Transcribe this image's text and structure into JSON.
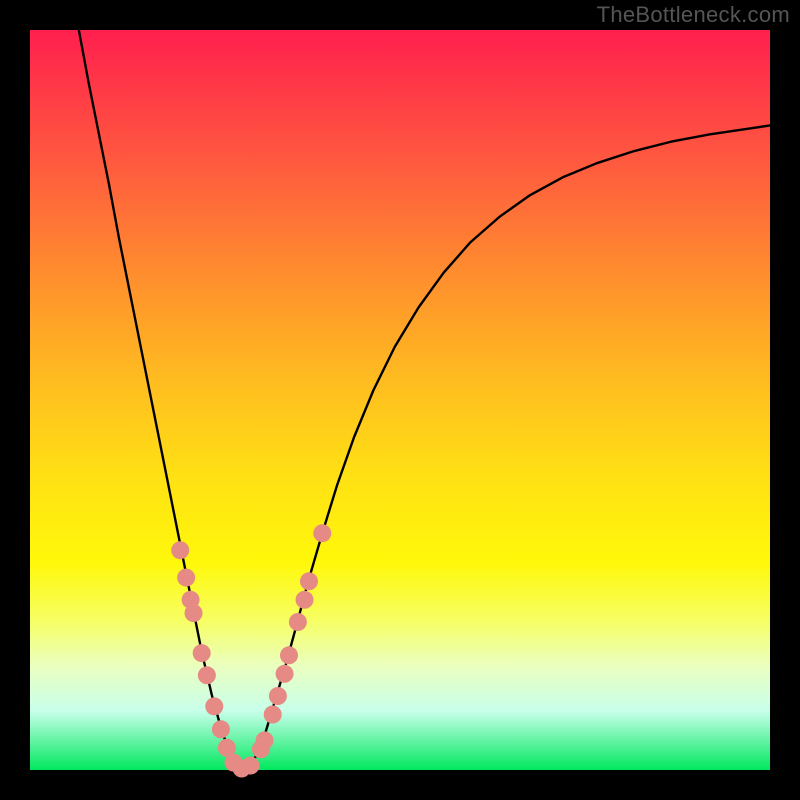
{
  "attribution": "TheBottleneck.com",
  "chart_data": {
    "type": "line",
    "title": "",
    "xlabel": "",
    "ylabel": "",
    "xlim": [
      0,
      1
    ],
    "ylim": [
      0,
      1
    ],
    "grid": false,
    "series": [
      {
        "name": "curve",
        "stroke": "#000000",
        "stroke_width": 2.4,
        "x": [
          0.066,
          0.079,
          0.093,
          0.107,
          0.12,
          0.134,
          0.148,
          0.162,
          0.176,
          0.19,
          0.204,
          0.218,
          0.232,
          0.246,
          0.26,
          0.272,
          0.281,
          0.289,
          0.296,
          0.306,
          0.318,
          0.33,
          0.345,
          0.36,
          0.376,
          0.395,
          0.415,
          0.438,
          0.464,
          0.493,
          0.525,
          0.559,
          0.595,
          0.635,
          0.676,
          0.72,
          0.766,
          0.815,
          0.866,
          0.919,
          0.973,
          1.0
        ],
        "y": [
          1.0,
          0.93,
          0.86,
          0.79,
          0.72,
          0.65,
          0.58,
          0.51,
          0.44,
          0.37,
          0.3,
          0.23,
          0.16,
          0.1,
          0.05,
          0.02,
          0.005,
          0.0,
          0.004,
          0.02,
          0.05,
          0.09,
          0.14,
          0.195,
          0.255,
          0.32,
          0.385,
          0.45,
          0.513,
          0.572,
          0.625,
          0.672,
          0.713,
          0.748,
          0.777,
          0.801,
          0.82,
          0.836,
          0.849,
          0.859,
          0.867,
          0.871
        ]
      }
    ],
    "markers": {
      "color": "#e58a84",
      "radius": 9,
      "points": [
        {
          "x": 0.203,
          "y": 0.297
        },
        {
          "x": 0.211,
          "y": 0.26
        },
        {
          "x": 0.217,
          "y": 0.23
        },
        {
          "x": 0.221,
          "y": 0.212
        },
        {
          "x": 0.232,
          "y": 0.158
        },
        {
          "x": 0.239,
          "y": 0.128
        },
        {
          "x": 0.249,
          "y": 0.086
        },
        {
          "x": 0.258,
          "y": 0.055
        },
        {
          "x": 0.266,
          "y": 0.03
        },
        {
          "x": 0.275,
          "y": 0.01
        },
        {
          "x": 0.286,
          "y": 0.002
        },
        {
          "x": 0.298,
          "y": 0.006
        },
        {
          "x": 0.312,
          "y": 0.028
        },
        {
          "x": 0.317,
          "y": 0.04
        },
        {
          "x": 0.328,
          "y": 0.075
        },
        {
          "x": 0.335,
          "y": 0.1
        },
        {
          "x": 0.344,
          "y": 0.13
        },
        {
          "x": 0.35,
          "y": 0.155
        },
        {
          "x": 0.362,
          "y": 0.2
        },
        {
          "x": 0.371,
          "y": 0.23
        },
        {
          "x": 0.377,
          "y": 0.255
        },
        {
          "x": 0.395,
          "y": 0.32
        }
      ]
    }
  }
}
